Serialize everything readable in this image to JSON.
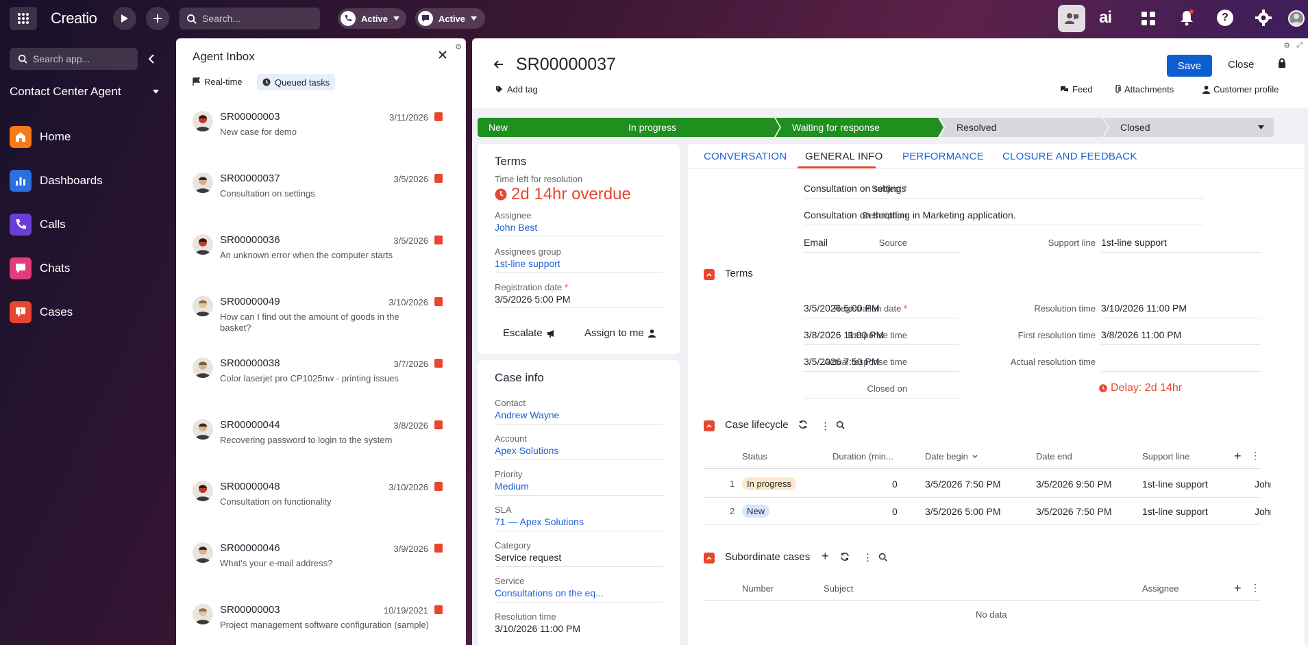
{
  "topbar": {
    "app_name": "Creatio",
    "search_placeholder": "Search...",
    "phone_status": "Active",
    "chat_status": "Active"
  },
  "nav": {
    "search_placeholder": "Search app...",
    "workspace": "Contact Center Agent",
    "items": [
      {
        "label": "Home",
        "icon": "home-icon",
        "color": "#f97a16"
      },
      {
        "label": "Dashboards",
        "icon": "bar-chart-icon",
        "color": "#2a6fdb"
      },
      {
        "label": "Calls",
        "icon": "phone-icon",
        "color": "#6a3fd8"
      },
      {
        "label": "Chats",
        "icon": "chat-icon",
        "color": "#e23c7a"
      },
      {
        "label": "Cases",
        "icon": "case-icon",
        "color": "#e8462f"
      }
    ]
  },
  "inbox": {
    "title": "Agent Inbox",
    "filters": [
      "Real-time",
      "Queued tasks"
    ],
    "items": [
      {
        "number": "SR00000003",
        "date": "3/11/2026",
        "subject": "New case for demo"
      },
      {
        "number": "SR00000037",
        "date": "3/5/2026",
        "subject": "Consultation on settings"
      },
      {
        "number": "SR00000036",
        "date": "3/5/2026",
        "subject": "An unknown error when the computer starts"
      },
      {
        "number": "SR00000049",
        "date": "3/10/2026",
        "subject": "How can I find out the amount of goods in the basket?"
      },
      {
        "number": "SR00000038",
        "date": "3/7/2026",
        "subject": "Color laserjet pro CP1025nw - printing issues"
      },
      {
        "number": "SR00000044",
        "date": "3/8/2026",
        "subject": "Recovering password to login to the system"
      },
      {
        "number": "SR00000048",
        "date": "3/10/2026",
        "subject": "Consultation on functionality"
      },
      {
        "number": "SR00000046",
        "date": "3/9/2026",
        "subject": "What's your e-mail address?"
      },
      {
        "number": "SR00000003",
        "date": "10/19/2021",
        "subject": "Project management software configuration (sample)"
      }
    ]
  },
  "record": {
    "number": "SR00000037",
    "add_tag": "Add tag",
    "save": "Save",
    "close": "Close",
    "actions": [
      "Feed",
      "Attachments",
      "Customer profile"
    ],
    "stages": [
      "New",
      "In progress",
      "Waiting for response",
      "Resolved",
      "Closed"
    ],
    "colors": {
      "stage_done": "#1f8f1f",
      "stage_todo": "#d8d8dc",
      "accent": "#1f5fd6",
      "overdue": "#e8462f",
      "save": "#0d5fd1"
    }
  },
  "terms_card": {
    "title": "Terms",
    "time_left_label": "Time left for resolution",
    "time_left_value": "2d 14hr overdue",
    "assignee_label": "Assignee",
    "assignee_value": "John Best",
    "group_label": "Assignees group",
    "group_value": "1st-line support",
    "reg_date_label": "Registration date",
    "reg_date_value": "3/5/2026 5:00 PM",
    "escalate": "Escalate",
    "assign_to_me": "Assign to me"
  },
  "case_info": {
    "title": "Case info",
    "fields": [
      {
        "label": "Contact",
        "value": "Andrew Wayne",
        "link": true
      },
      {
        "label": "Account",
        "value": "Apex Solutions",
        "link": true
      },
      {
        "label": "Priority",
        "value": "Medium",
        "link": true
      },
      {
        "label": "SLA",
        "value": "71 — Apex Solutions",
        "link": true
      },
      {
        "label": "Category",
        "value": "Service request",
        "link": false
      },
      {
        "label": "Service",
        "value": "Consultations on the eq...",
        "link": true
      },
      {
        "label": "Resolution time",
        "value": "3/10/2026 11:00 PM",
        "link": false
      }
    ]
  },
  "tabs": [
    "CONVERSATION",
    "GENERAL INFO",
    "PERFORMANCE",
    "CLOSURE AND FEEDBACK"
  ],
  "general": {
    "subject_label": "Subject",
    "subject_value": "Consultation on settings",
    "description_label": "Description",
    "description_value": "Consultation on throttling in Marketing application.",
    "source_label": "Source",
    "source_value": "Email",
    "support_line_label": "Support line",
    "support_line_value": "1st-line support"
  },
  "terms_section": {
    "title": "Terms",
    "reg_label": "Registration date",
    "reg_value": "3/5/2026 5:00 PM",
    "resolution_time_label": "Resolution time",
    "resolution_time_value": "3/10/2026 11:00 PM",
    "response_time_label": "Response time",
    "response_time_value": "3/8/2026 11:00 PM",
    "first_resolution_label": "First resolution time",
    "first_resolution_value": "3/8/2026 11:00 PM",
    "actual_response_label": "Actual response time",
    "actual_response_value": "3/5/2026 7:50 PM",
    "actual_resolution_label": "Actual resolution time",
    "actual_resolution_value": "",
    "closed_on_label": "Closed on",
    "closed_on_value": "",
    "delay": "Delay: 2d 14hr"
  },
  "lifecycle": {
    "title": "Case lifecycle",
    "columns": [
      "Status",
      "Duration (min...",
      "Date begin",
      "Date end",
      "Support line"
    ],
    "rows": [
      {
        "n": "1",
        "status": "In progress",
        "duration": "0",
        "begin": "3/5/2026 7:50 PM",
        "end": "3/5/2026 9:50 PM",
        "line": "1st-line support",
        "assignee": "John B"
      },
      {
        "n": "2",
        "status": "New",
        "duration": "0",
        "begin": "3/5/2026 5:00 PM",
        "end": "3/5/2026 7:50 PM",
        "line": "1st-line support",
        "assignee": "John B"
      }
    ]
  },
  "subordinate": {
    "title": "Subordinate cases",
    "columns": [
      "Number",
      "Subject",
      "Assignee"
    ],
    "empty": "No data"
  }
}
